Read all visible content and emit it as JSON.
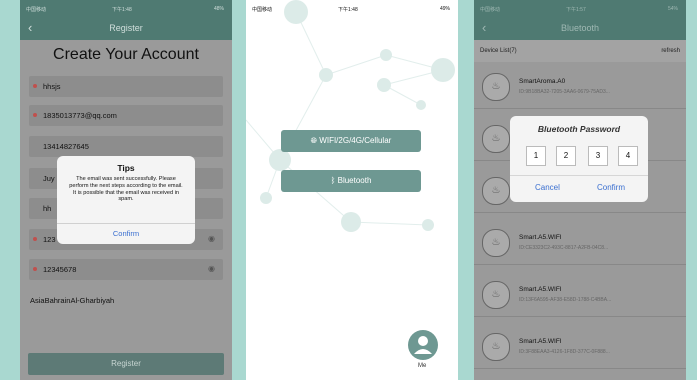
{
  "register": {
    "status_carrier": "中国移动",
    "status_time": "下午1:48",
    "status_battery": "48%",
    "back": "‹",
    "title": "Register",
    "heading": "Create Your Account",
    "fields": [
      {
        "value": "hhsjs",
        "required": true
      },
      {
        "value": "1835013773@qq.com",
        "required": true
      },
      {
        "value": "13414827645",
        "required": false
      },
      {
        "value": "Juy",
        "required": false
      },
      {
        "value": "hh",
        "required": false
      },
      {
        "value": "123",
        "required": true,
        "password": true
      },
      {
        "value": "12345678",
        "required": true,
        "password": true
      }
    ],
    "region": "AsiaBahrainAl-Gharbiyah",
    "register_button": "Register",
    "tips": {
      "title": "Tips",
      "message": "The email was sent successfully. Please perform the next steps according to the email. It is possible that the email was received in spam.",
      "confirm": "Confirm"
    }
  },
  "connect": {
    "status_carrier": "中国移动",
    "status_time": "下午1:48",
    "status_battery": "49%",
    "wifi_button": "WIFI/2G/4G/Cellular",
    "bluetooth_button": "Bluetooth",
    "me_label": "Me"
  },
  "bluetooth": {
    "status_carrier": "中国移动",
    "status_time": "下午1:57",
    "status_battery": "54%",
    "back": "‹",
    "title": "Bluetooth",
    "device_list_label": "Device List(7)",
    "refresh": "refresh",
    "devices": [
      {
        "name": "SmartAroma.A0",
        "id": "ID:9B18BA32-7205-3AA6-0679-75AD3..."
      },
      {
        "name": "",
        "id": ""
      },
      {
        "name": "",
        "id": ""
      },
      {
        "name": "Smart.A5.WIFI",
        "id": "ID:CE3323C2-493C-8817-A2FB-04C8..."
      },
      {
        "name": "Smart.A5.WIFI",
        "id": "ID:13F6A595-AF38-E58D-1788-C4BBA..."
      },
      {
        "name": "Smart.A5.WIFI",
        "id": "ID:3F88EAA3-4126-1F8D-377C-0F888..."
      }
    ],
    "dialog": {
      "title": "Bluetooth Password",
      "digits": [
        "1",
        "2",
        "3",
        "4"
      ],
      "cancel": "Cancel",
      "confirm": "Confirm"
    }
  },
  "colors": {
    "background": "#a9d8d0",
    "header": "#4f7a72",
    "button": "#6e9892",
    "link": "#3a6fd0"
  }
}
